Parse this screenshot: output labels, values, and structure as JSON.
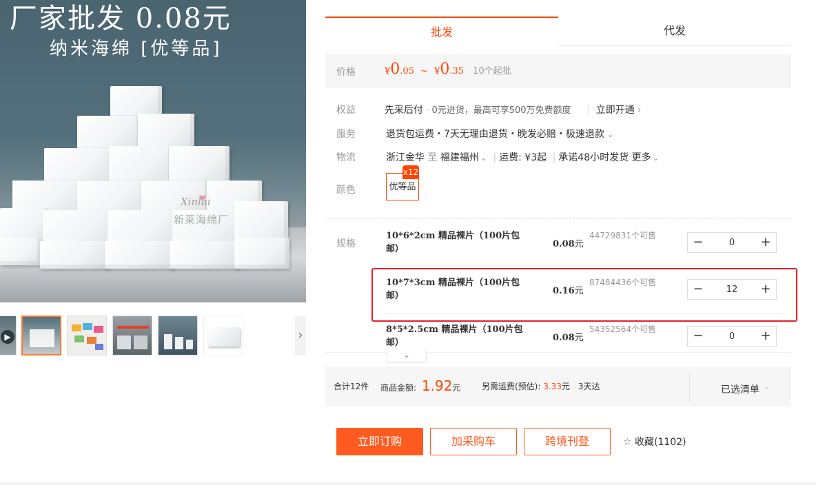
{
  "hero": {
    "headline": "厂家批发  0.08元",
    "subline": "纳米海绵 [优等品]",
    "watermark": "新莱海绵厂",
    "watermark_script": "Xinlai"
  },
  "thumbnails": {
    "count": 6,
    "active_index": 1
  },
  "tabs": [
    {
      "label": "批发",
      "active": true
    },
    {
      "label": "代发",
      "active": false
    }
  ],
  "price": {
    "label": "价格",
    "currency": "¥",
    "low_int": "0",
    "low_dec": ".05",
    "tilde": "~",
    "high_int": "0",
    "high_dec": ".35",
    "min_order": "10个起批"
  },
  "benefits": {
    "label": "权益",
    "title": "先采后付",
    "text": "0元进货，最高可享500万免费额度",
    "link": "立即开通"
  },
  "service": {
    "label": "服务",
    "text": "退货包运费・7天无理由退货・晚发必赔・极速退款"
  },
  "logistics": {
    "label": "物流",
    "from": "浙江金华",
    "to_word": "至",
    "to": "福建福州",
    "fee": "运费: ¥3起",
    "promise": "承诺48小时发货",
    "more": "更多"
  },
  "color": {
    "label": "颜色",
    "option": "优等品",
    "badge": "x12"
  },
  "spec": {
    "label": "规格",
    "rows": [
      {
        "name": "10*6*2cm 精品裸片（100片包邮）",
        "price": "0.08",
        "unit": "元",
        "stock": "44729831个可售",
        "qty": "0"
      },
      {
        "name": "10*7*3cm 精品裸片（100片包邮）",
        "price": "0.16",
        "unit": "元",
        "stock": "87484436个可售",
        "qty": "12"
      },
      {
        "name": "8*5*2.5cm 精品裸片（100片包邮）",
        "price": "0.08",
        "unit": "元",
        "stock": "54352564个可售",
        "qty": "0"
      }
    ]
  },
  "summary": {
    "count": "合计12件",
    "amount_label": "商品金额:",
    "amount": "1.92",
    "amount_unit": "元",
    "shipping_label": "另需运费(预估):",
    "shipping": "3.33",
    "shipping_unit": "元",
    "eta": "3天达",
    "selected": "已选清单"
  },
  "actions": {
    "order": "立即订购",
    "cart": "加采购车",
    "crossborder": "跨境刊登",
    "favorite": "收藏(1102)"
  },
  "colors": {
    "accent": "#ff4400",
    "button": "#ff5a1f",
    "highlight": "#e8202a"
  }
}
